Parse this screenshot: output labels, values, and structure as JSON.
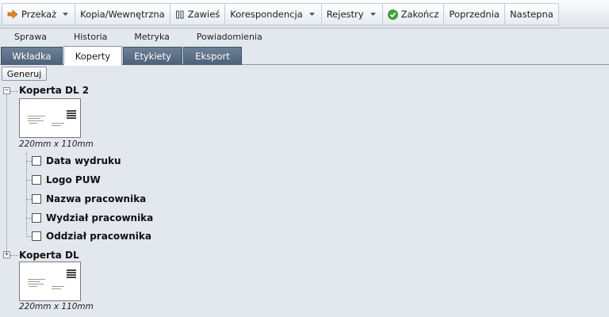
{
  "toolbar": {
    "przekaz": "Przekaż",
    "kopia": "Kopia/Wewnętrzna",
    "zawies": "Zawieś",
    "korespondencja": "Korespondencja",
    "rejestry": "Rejestry",
    "zakoncz": "Zakończ",
    "poprzednia": "Poprzednia",
    "nastepna": "Nastepna"
  },
  "tabs1": [
    "Sprawa",
    "Historia",
    "Metryka",
    "Powiadomienia"
  ],
  "tabs2": [
    "Wkładka",
    "Koperty",
    "Etykiety",
    "Eksport"
  ],
  "generate_button": "Generuj",
  "tree": [
    {
      "title": "Koperta DL 2",
      "expanded": true,
      "size": "220mm x 110mm",
      "options": [
        "Data wydruku",
        "Logo PUW",
        "Nazwa pracownika",
        "Wydział pracownika",
        "Oddział pracownika"
      ]
    },
    {
      "title": "Koperta DL",
      "expanded": false,
      "size": "220mm x 110mm"
    }
  ],
  "colors": {
    "accent_arrow": "#e8842a",
    "ok_icon": "#3aa83a",
    "tab_dark": "#56697f"
  }
}
